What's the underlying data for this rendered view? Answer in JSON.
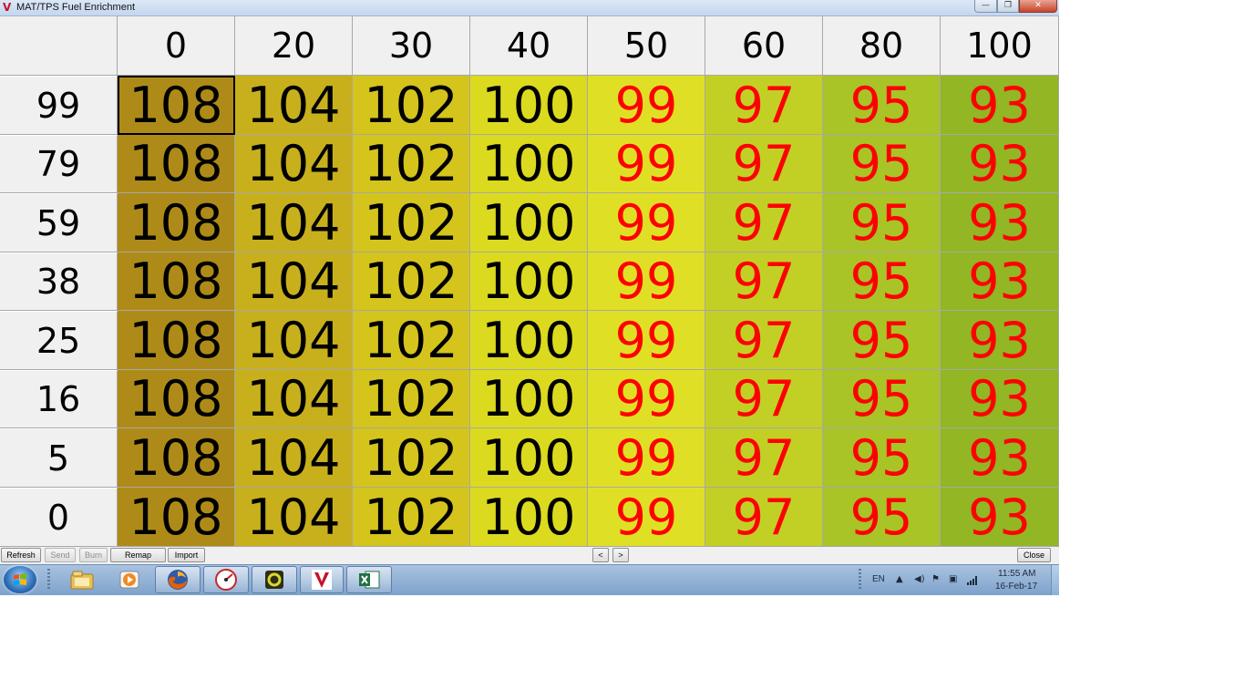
{
  "window": {
    "title": "MAT/TPS Fuel Enrichment",
    "app_icon": "V",
    "min_glyph": "—",
    "max_glyph": "❐",
    "close_glyph": "✕"
  },
  "table": {
    "column_headers": [
      "0",
      "20",
      "30",
      "40",
      "50",
      "60",
      "80",
      "100"
    ],
    "row_headers": [
      "99",
      "79",
      "59",
      "38",
      "25",
      "16",
      "5",
      "0"
    ],
    "rows": [
      [
        "108",
        "104",
        "102",
        "100",
        "99",
        "97",
        "95",
        "93"
      ],
      [
        "108",
        "104",
        "102",
        "100",
        "99",
        "97",
        "95",
        "93"
      ],
      [
        "108",
        "104",
        "102",
        "100",
        "99",
        "97",
        "95",
        "93"
      ],
      [
        "108",
        "104",
        "102",
        "100",
        "99",
        "97",
        "95",
        "93"
      ],
      [
        "108",
        "104",
        "102",
        "100",
        "99",
        "97",
        "95",
        "93"
      ],
      [
        "108",
        "104",
        "102",
        "100",
        "99",
        "97",
        "95",
        "93"
      ],
      [
        "108",
        "104",
        "102",
        "100",
        "99",
        "97",
        "95",
        "93"
      ],
      [
        "108",
        "104",
        "102",
        "100",
        "99",
        "97",
        "95",
        "93"
      ]
    ],
    "column_colors": [
      "#ae8b18",
      "#c8b01c",
      "#d4c41c",
      "#dcda1e",
      "#dfe025",
      "#c2d026",
      "#a8c426",
      "#92b624"
    ],
    "red_text_columns": [
      4,
      5,
      6,
      7
    ],
    "selected_cell": [
      0,
      0
    ]
  },
  "toolbar": {
    "refresh": "Refresh",
    "send": "Send",
    "burn": "Burn",
    "remap": "Remap",
    "import": "Import",
    "prev": "<",
    "next": ">",
    "close": "Close"
  },
  "taskbar": {
    "language": "EN",
    "time": "11:55 AM",
    "date": "16-Feb-17",
    "apps": [
      "windows-explorer-icon",
      "media-player-icon",
      "firefox-icon",
      "gauge-app-icon",
      "sync-app-icon",
      "vemstune-icon",
      "excel-icon"
    ]
  }
}
